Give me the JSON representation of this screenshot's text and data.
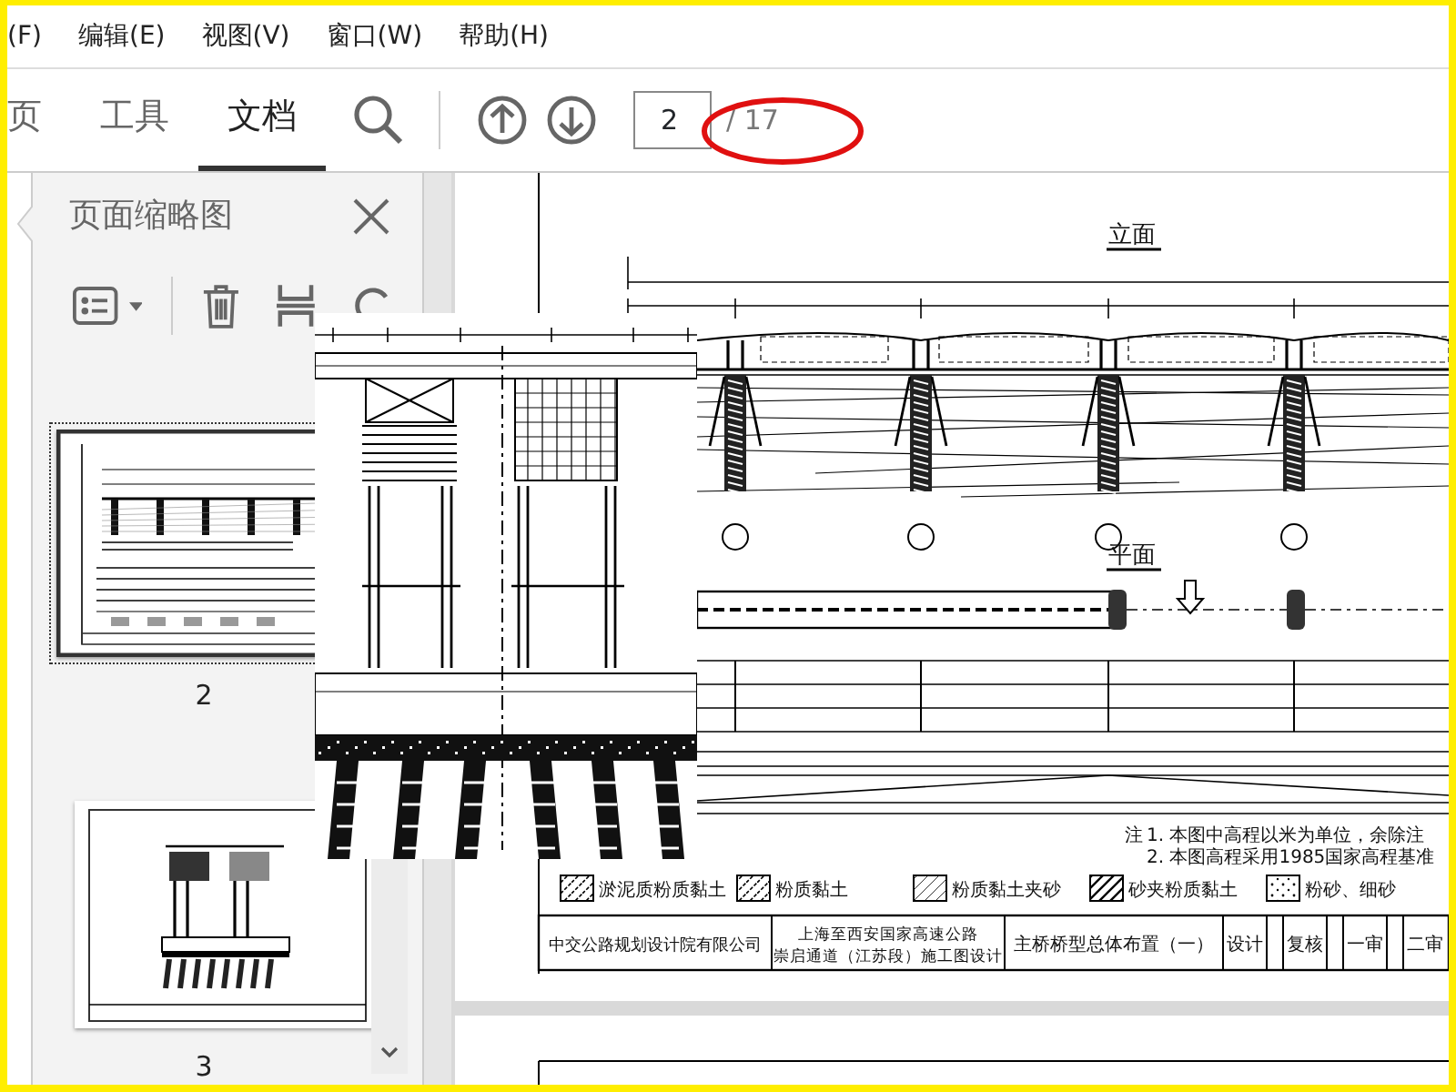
{
  "menu": [
    "(F)",
    "编辑(E)",
    "视图(V)",
    "窗口(W)",
    "帮助(H)"
  ],
  "tabs": [
    {
      "label": "页",
      "selected": false
    },
    {
      "label": "工具",
      "selected": false
    },
    {
      "label": "文档",
      "selected": true
    }
  ],
  "page_nav": {
    "current": "2",
    "total": "/ 17"
  },
  "thumbnail_panel": {
    "title": "页面缩略图",
    "thumbnails": [
      {
        "label": "2",
        "selected": true,
        "kind": "layout"
      },
      {
        "label": "3",
        "selected": false,
        "kind": "pier"
      }
    ]
  },
  "document": {
    "elevation_title": "立面",
    "plan_title": "平面",
    "notes_heading": "注",
    "notes": [
      "1. 本图中高程以米为单位，余除注",
      "2. 本图高程采用1985国家高程基准"
    ],
    "legend": [
      {
        "label": "淤泥质粉质黏土",
        "kind": "dashed"
      },
      {
        "label": "粉质黏土",
        "kind": "dashed"
      },
      {
        "label": "粉质黏土夹砂",
        "kind": "light"
      },
      {
        "label": "砂夹粉质黏土",
        "kind": "dense"
      },
      {
        "label": "粉砂、细砂",
        "kind": "dots"
      }
    ],
    "title_block": {
      "company": "中交公路规划设计院有限公司",
      "project": [
        "上海至西安国家高速公路",
        "崇启通道（江苏段）施工图设计"
      ],
      "drawing_title": "主桥桥型总体布置（一）",
      "fields": [
        "设计",
        "复核",
        "一审",
        "二审"
      ]
    }
  }
}
